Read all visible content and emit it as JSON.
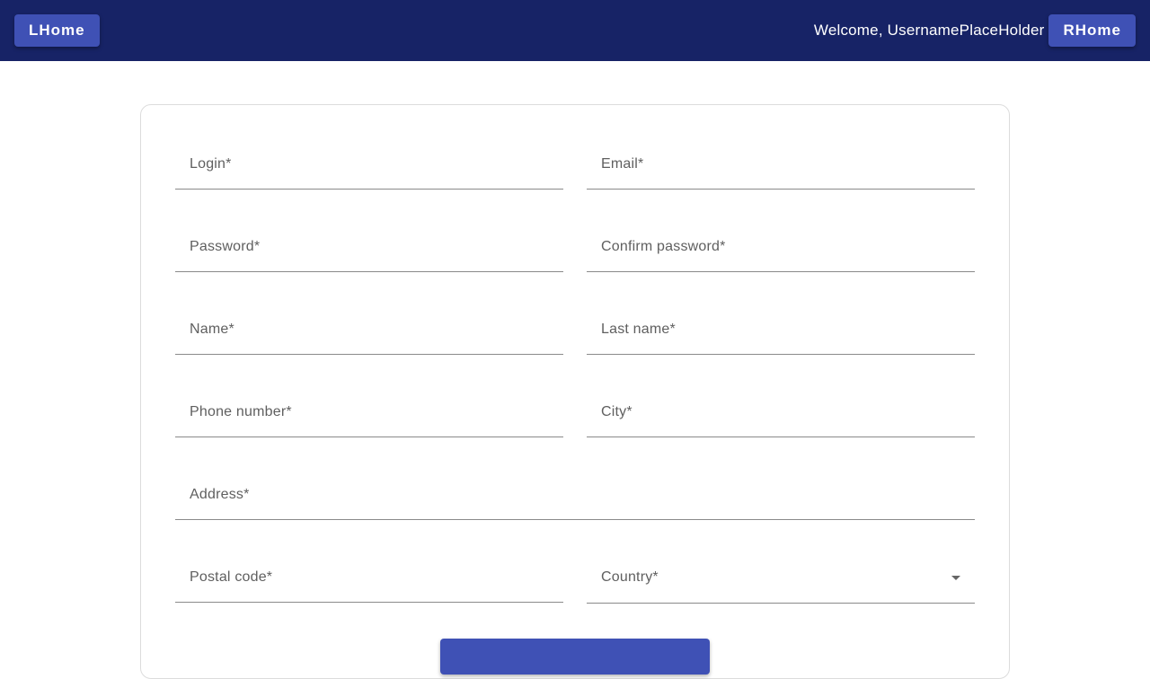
{
  "header": {
    "left_button": "LHome",
    "welcome_text": "Welcome, UsernamePlaceHolder",
    "right_button": "RHome"
  },
  "form": {
    "login_label": "Login*",
    "email_label": "Email*",
    "password_label": "Password*",
    "confirm_password_label": "Confirm password*",
    "name_label": "Name*",
    "last_name_label": "Last name*",
    "phone_label": "Phone number*",
    "city_label": "City*",
    "address_label": "Address*",
    "postal_code_label": "Postal code*",
    "country_label": "Country*",
    "country_icon": "dropdown-arrow-icon"
  },
  "colors": {
    "topbar": "#172366",
    "button": "#3f51b5"
  }
}
